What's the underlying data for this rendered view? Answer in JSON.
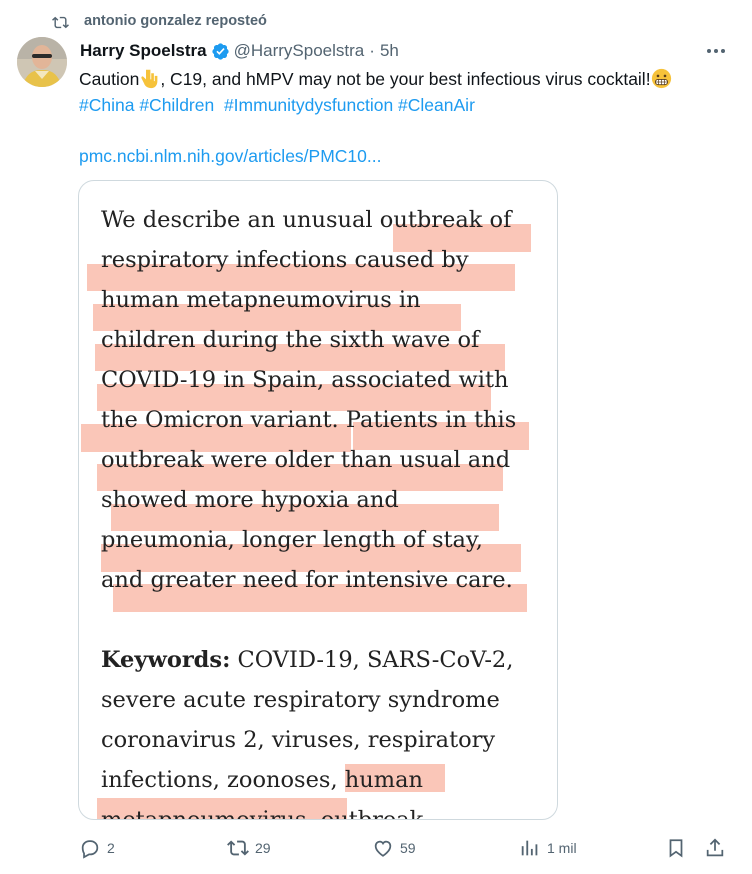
{
  "repost": {
    "text": "antonio gonzalez reposteó",
    "icon": "repost-icon"
  },
  "tweet": {
    "author_name": "Harry Spoelstra",
    "handle": "@HarrySpoelstra",
    "separator": "·",
    "time": "5h",
    "text_before_emoji": "Caution",
    "text_after_emoji": ", C19, and hMPV may not be your best infectious virus cocktail!",
    "hashtags": "#China #Children  #Immunitydysfunction #CleanAir",
    "link": "pmc.ncbi.nlm.nih.gov/articles/PMC10..."
  },
  "card": {
    "lines": [
      "We describe an unusual outbreak of",
      "respiratory infections caused by",
      "human metapneumovirus in",
      "children during the sixth wave of",
      "COVID-19 in Spain, associated with",
      "the Omicron variant. Patients in this",
      "outbreak were older than usual and",
      "showed more hypoxia and",
      "pneumonia, longer length of stay,",
      "and greater need for intensive care."
    ],
    "keywords_label": "Keywords:",
    "keywords_line1": " COVID-19, SARS-CoV-2,",
    "keywords_lines": [
      "severe acute respiratory syndrome",
      "coronavirus 2, viruses, respiratory",
      "infections, zoonoses, human",
      "metapneumovirus, outbreak"
    ]
  },
  "actions": {
    "replies": "2",
    "reposts": "29",
    "likes": "59",
    "views": "1 mil"
  },
  "colors": {
    "link": "#1d9bf0",
    "muted": "#536471",
    "highlight": "#f7a892",
    "verified": "#1d9bf0"
  }
}
